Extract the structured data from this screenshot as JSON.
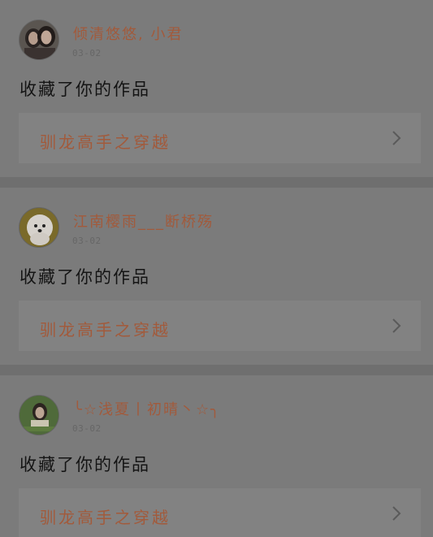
{
  "feed": {
    "items": [
      {
        "username": "倾清悠悠, 小君",
        "date": "03-02",
        "action": "收藏了你的作品",
        "work_title": "驯龙高手之穿越",
        "avatar_icon": "two-girls-photo-avatar",
        "chevron_icon": "chevron-right-icon"
      },
      {
        "username": "江南樱雨___断桥殇",
        "date": "03-02",
        "action": "收藏了你的作品",
        "work_title": "驯龙高手之穿越",
        "avatar_icon": "white-dog-photo-avatar",
        "chevron_icon": "chevron-right-icon"
      },
      {
        "username": "╰☆浅夏丨初晴丶☆╮",
        "date": "03-02",
        "action": "收藏了你的作品",
        "work_title": "驯龙高手之穿越",
        "avatar_icon": "girl-green-photo-avatar",
        "chevron_icon": "chevron-right-icon"
      }
    ]
  },
  "colors": {
    "overlay_background": "#6f6f6f",
    "card_background": "#7b7b7b",
    "link_box_background": "#828282",
    "accent_text": "#a25a3b",
    "body_text": "#141414",
    "muted_text": "#666666"
  }
}
